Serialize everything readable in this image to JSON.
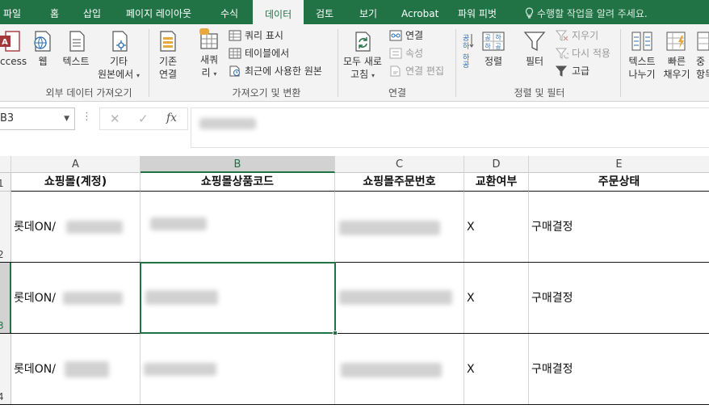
{
  "ribbon_tabs": [
    {
      "label": "파일"
    },
    {
      "label": "홈"
    },
    {
      "label": "삽입"
    },
    {
      "label": "페이지 레이아웃"
    },
    {
      "label": "수식"
    },
    {
      "label": "데이터",
      "active": true
    },
    {
      "label": "검토"
    },
    {
      "label": "보기"
    },
    {
      "label": "Acrobat"
    },
    {
      "label": "파워 피벗"
    }
  ],
  "tell_me": "수행할 작업을 알려 주세요.",
  "ribbon": {
    "external": {
      "access": "Access",
      "web": "웹",
      "text": "텍스트",
      "other_line1": "기타",
      "other_line2": "원본에서",
      "group_label": "외부 데이터 가져오기"
    },
    "get_transform": {
      "existing_line1": "기존",
      "existing_line2": "연결",
      "new_query_line1": "새쿼",
      "new_query_line2": "리",
      "show_queries": "쿼리 표시",
      "from_table": "테이블에서",
      "recent_sources": "최근에 사용한 원본",
      "group_label": "가져오기 및 변환"
    },
    "connections": {
      "refresh_line1": "모두 새로",
      "refresh_line2": "고침",
      "connections": "연결",
      "properties": "속성",
      "edit_links": "연결 편집",
      "group_label": "연결"
    },
    "sort_filter": {
      "sort": "정렬",
      "filter": "필터",
      "clear": "지우기",
      "reapply": "다시 적용",
      "advanced": "고급",
      "sort_icon_text_top": "공하",
      "sort_icon_text_bottom": "하공",
      "group_label": "정렬 및 필터"
    },
    "data_tools": {
      "text_to_columns_line1": "텍스트",
      "text_to_columns_line2": "나누기",
      "flash_fill_line1": "빠른",
      "flash_fill_line2": "채우기",
      "remove_dup_line1": "중",
      "remove_dup_line2": "항목"
    }
  },
  "formula_bar": {
    "name_box": "B3",
    "cancel": "✕",
    "enter": "✓",
    "fx": "fx"
  },
  "sheet": {
    "columns": [
      "A",
      "B",
      "C",
      "D",
      "E"
    ],
    "selected_column": "B",
    "headers": [
      "쇼핑몰(계정)",
      "쇼핑몰상품코드",
      "쇼핑몰주문번호",
      "교환여부",
      "주문상태"
    ],
    "rows": [
      {
        "row_number": "2",
        "mall": "롯데ON/",
        "exchange": "X",
        "status": "구매결정"
      },
      {
        "row_number": "3",
        "mall": "롯데ON/",
        "exchange": "X",
        "status": "구매결정"
      },
      {
        "row_number": "4",
        "mall": "롯데ON/",
        "exchange": "X",
        "status": "구매결정"
      }
    ],
    "header_row_number": "1",
    "selected_cell": "B3"
  },
  "colors": {
    "excel_green": "#217346",
    "ribbon_bg": "#f3f3f3"
  }
}
